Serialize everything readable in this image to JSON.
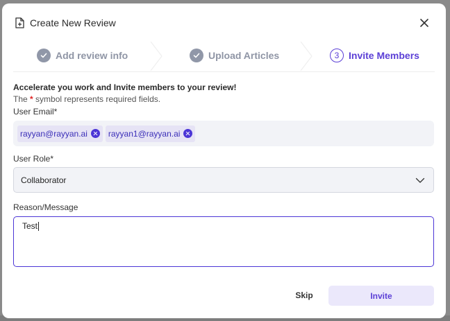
{
  "dialog": {
    "title": "Create New Review"
  },
  "steps": [
    {
      "number": "",
      "label": "Add review info",
      "state": "done",
      "icon": "check-icon"
    },
    {
      "number": "",
      "label": "Upload Articles",
      "state": "done",
      "icon": "check-icon"
    },
    {
      "number": "3",
      "label": "Invite Members",
      "state": "active",
      "icon": ""
    }
  ],
  "form": {
    "intro": "Accelerate you work and Invite members to your review!",
    "required_note_prefix": "The ",
    "required_symbol": "*",
    "required_note_suffix": " symbol represents required fields.",
    "email_label": "User Email*",
    "emails": [
      "rayyan@rayyan.ai",
      "rayyan1@rayyan.ai"
    ],
    "role_label": "User Role*",
    "role_value": "Collaborator",
    "message_label": "Reason/Message",
    "message_value": "Test"
  },
  "actions": {
    "skip_label": "Skip",
    "invite_label": "Invite"
  },
  "colors": {
    "accent": "#5b3fd6",
    "step_done": "#9097a8",
    "chip_bg": "#e6e3f5",
    "required": "#e02424"
  }
}
